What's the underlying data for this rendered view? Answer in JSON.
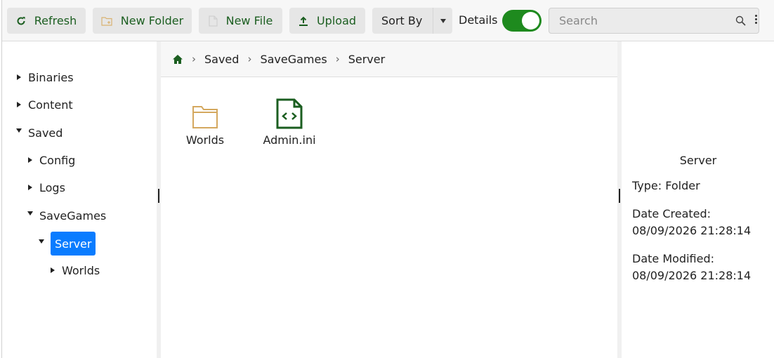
{
  "toolbar": {
    "refresh_label": "Refresh",
    "new_folder_label": "New Folder",
    "new_file_label": "New File",
    "upload_label": "Upload",
    "sort_label": "Sort By",
    "details_label": "Details",
    "details_on": true,
    "search_placeholder": "Search",
    "accent_color": "#1b5e20"
  },
  "tree": {
    "items": [
      {
        "label": "Binaries",
        "expanded": false
      },
      {
        "label": "Content",
        "expanded": false
      },
      {
        "label": "Saved",
        "expanded": true
      },
      {
        "label": "Config",
        "expanded": false
      },
      {
        "label": "Logs",
        "expanded": false
      },
      {
        "label": "SaveGames",
        "expanded": true
      },
      {
        "label": "Server",
        "expanded": true,
        "selected": true
      },
      {
        "label": "Worlds",
        "expanded": false
      }
    ],
    "selected_color": "#0a7cff"
  },
  "breadcrumb": {
    "home_icon": "home-icon",
    "parts": [
      "Saved",
      "SaveGames",
      "Server"
    ]
  },
  "files": [
    {
      "name": "Worlds",
      "icon": "folder-icon"
    },
    {
      "name": "Admin.ini",
      "icon": "code-file-icon"
    }
  ],
  "details": {
    "title": "Server",
    "type_line": "Type: Folder",
    "created_label": "Date Created:",
    "created_value": "08/09/2026 21:28:14",
    "modified_label": "Date Modified:",
    "modified_value": "08/09/2026 21:28:14"
  }
}
